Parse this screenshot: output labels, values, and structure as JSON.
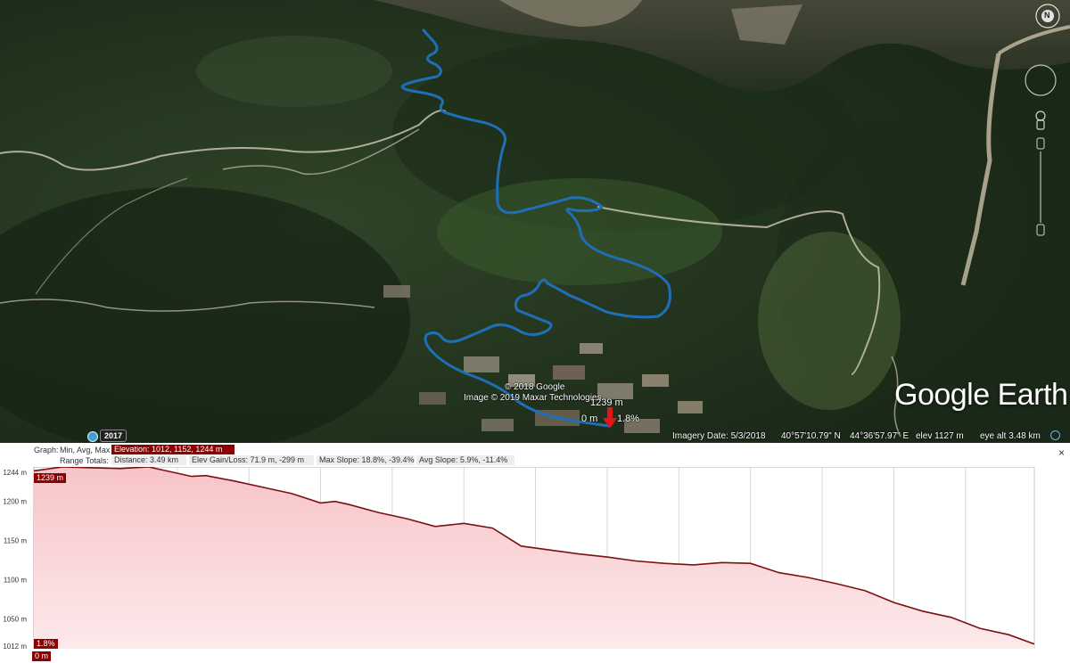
{
  "map": {
    "copyright_1": "© 2018 Google",
    "copyright_2": "Image © 2019 Maxar Technologies",
    "marker_elevation": "1239 m",
    "marker_distance": "0 m",
    "marker_slope": "1.8%",
    "logo": "Google Earth",
    "year_badge": "2017",
    "status": {
      "imagery_date": "Imagery Date: 5/3/2018",
      "latitude": "40°57'10.79\" N",
      "longitude": "44°36'57.97\" E",
      "elevation": "elev  1127 m",
      "eye_alt": "eye alt  3.48 km"
    },
    "compass_label": "N",
    "colors": {
      "track": "#1f6fb8",
      "marker": "#e0161b"
    }
  },
  "graph": {
    "toolbar": {
      "graph_label": "Graph:",
      "graph_mode": "Min, Avg, Max",
      "elevation": "Elevation: 1012, 1152, 1244 m",
      "range_label": "Range Totals:",
      "distance": "Distance: 3.49 km",
      "elev_gain": "Elev Gain/Loss: 71.9 m, -299 m",
      "max_slope": "Max Slope: 18.8%, -39.4%",
      "avg_slope": "Avg Slope: 5.9%, -11.4%"
    },
    "close_label": "×",
    "cursor_elev_label": "1239 m",
    "cursor_slope_label": "1.8%",
    "cursor_dist_label": "0 m",
    "y_ticks": [
      "1244 m",
      "1200 m",
      "1150 m",
      "1100 m",
      "1050 m",
      "1012 m"
    ],
    "x_ticks": [
      "0.25 km",
      "0.5 km",
      "0.75 km",
      "1 km",
      "1.25 km",
      "1.5 km",
      "1.75 km",
      "2 km",
      "2.25 km",
      "2.5 km",
      "2.75 km",
      "3 km",
      "3.25 km",
      "3.49 km"
    ],
    "colors": {
      "line": "#7a1010",
      "fill_top": "#f7c4c8",
      "fill_bottom": "#fde9eb",
      "grid": "#cfcfcf",
      "badge": "#8b0000"
    }
  },
  "chart_data": {
    "type": "area",
    "xlabel": "",
    "ylabel": "",
    "xlim": [
      0,
      3.49
    ],
    "ylim": [
      1012,
      1244
    ],
    "grid": true,
    "x": [
      0,
      0.1,
      0.2,
      0.3,
      0.4,
      0.5,
      0.55,
      0.6,
      0.7,
      0.8,
      0.9,
      1.0,
      1.05,
      1.1,
      1.2,
      1.3,
      1.4,
      1.5,
      1.6,
      1.7,
      1.8,
      1.9,
      2.0,
      2.1,
      2.2,
      2.3,
      2.4,
      2.5,
      2.6,
      2.7,
      2.8,
      2.9,
      3.0,
      3.1,
      3.2,
      3.3,
      3.4,
      3.49
    ],
    "y": [
      1239,
      1244,
      1243,
      1242,
      1244,
      1236,
      1232,
      1233,
      1226,
      1218,
      1210,
      1198,
      1200,
      1196,
      1186,
      1178,
      1168,
      1172,
      1166,
      1143,
      1138,
      1133,
      1129,
      1124,
      1121,
      1119,
      1122,
      1121,
      1109,
      1103,
      1095,
      1086,
      1071,
      1060,
      1052,
      1038,
      1030,
      1018
    ]
  }
}
